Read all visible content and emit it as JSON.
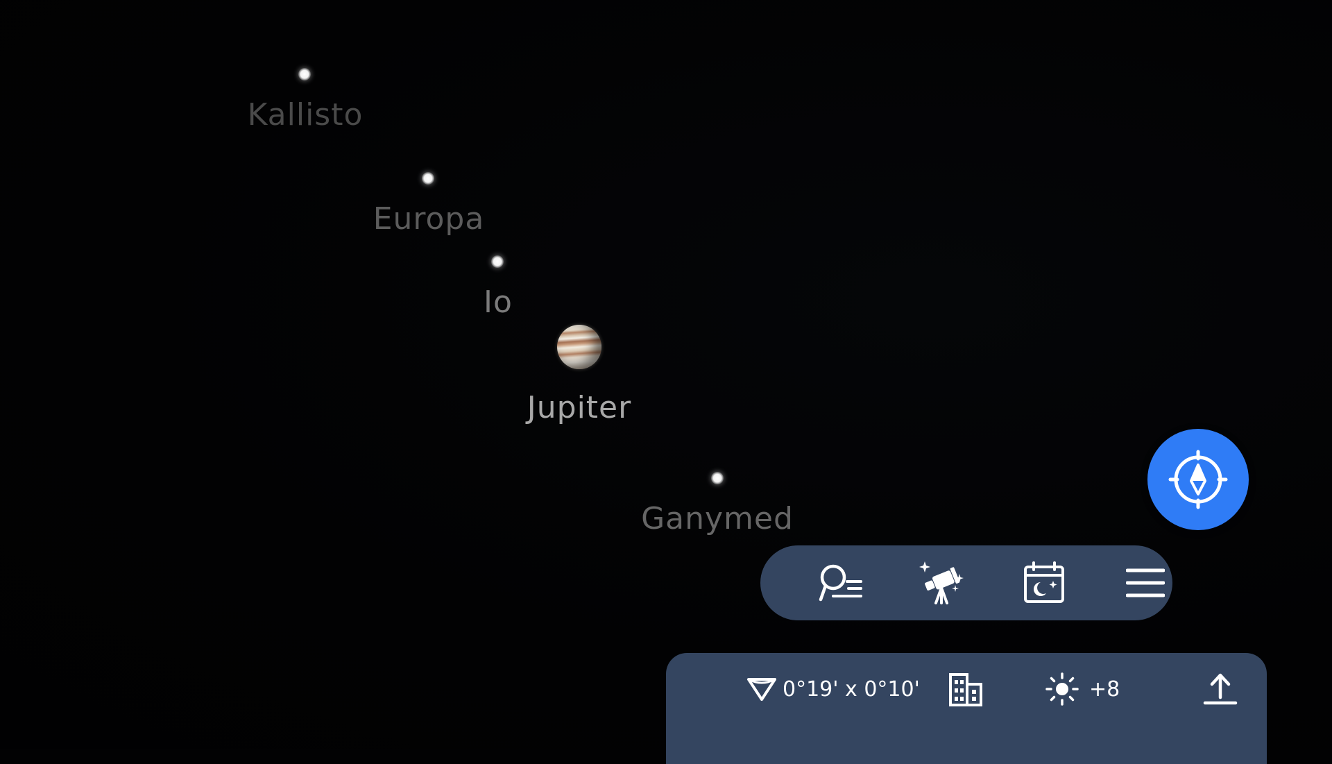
{
  "sky_objects": {
    "kallisto": {
      "label": "Kallisto",
      "label_color": "#4a4a4a"
    },
    "europa": {
      "label": "Europa",
      "label_color": "#5c5c5c"
    },
    "io": {
      "label": "Io",
      "label_color": "#7b7b7b"
    },
    "jupiter": {
      "label": "Jupiter",
      "label_color": "#a8a8a8"
    },
    "ganymed": {
      "label": "Ganymed",
      "label_color": "#666666"
    }
  },
  "compass_button": {
    "icon": "compass-icon",
    "color": "#2f7cf6"
  },
  "toolbar": {
    "background": "#344560",
    "items": [
      {
        "icon": "search-list-icon"
      },
      {
        "icon": "telescope-icon"
      },
      {
        "icon": "night-calendar-icon"
      },
      {
        "icon": "menu-icon"
      }
    ]
  },
  "status_bar": {
    "field_of_view": {
      "icon": "field-of-view-icon",
      "value": "0°19' x 0°10'"
    },
    "landscape": {
      "icon": "buildings-icon"
    },
    "brightness": {
      "icon": "sun-icon",
      "value": "+8"
    },
    "share": {
      "icon": "share-upload-icon"
    }
  }
}
